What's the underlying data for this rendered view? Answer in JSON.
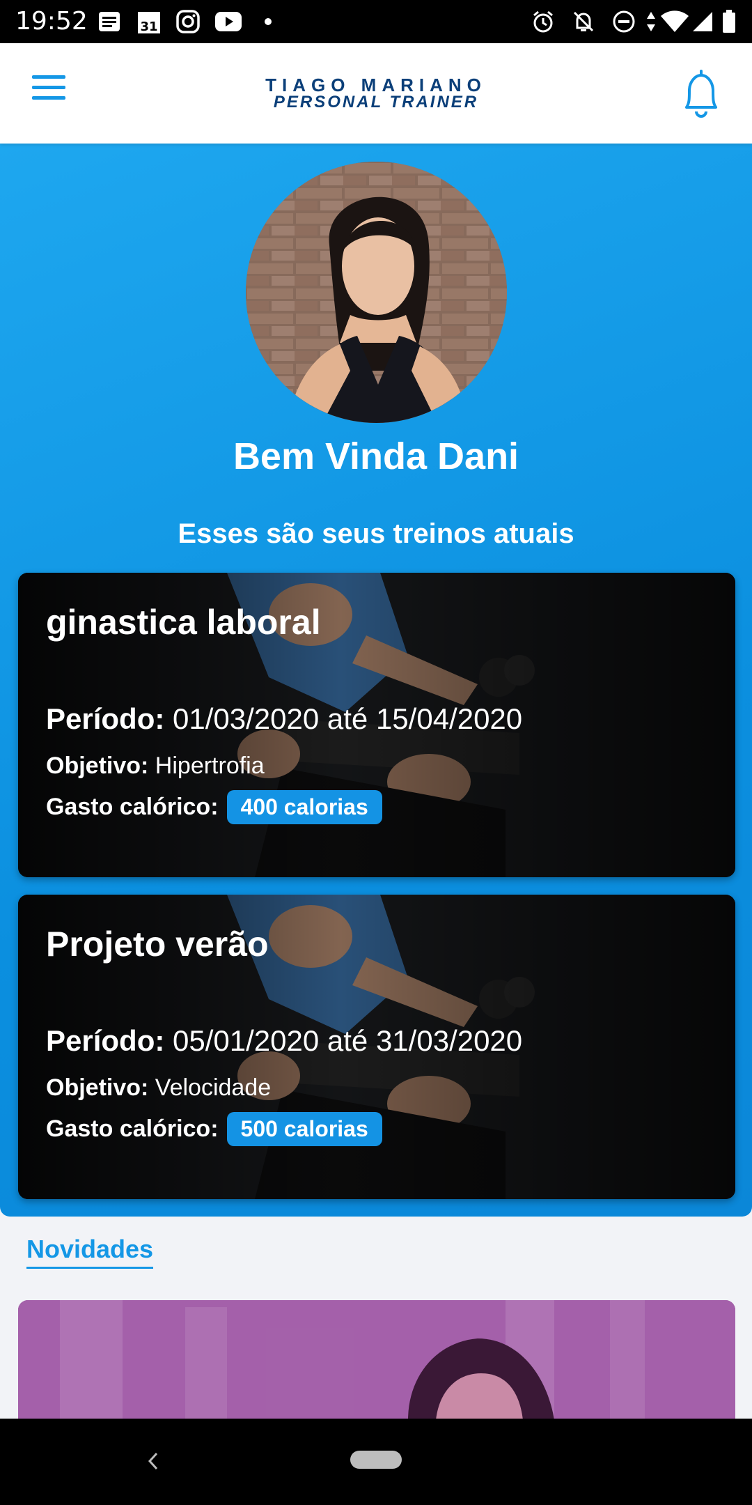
{
  "status_bar": {
    "time": "19:52",
    "icons": [
      "news-icon",
      "calendar-icon",
      "instagram-icon",
      "youtube-icon",
      "dot-icon",
      "alarm-icon",
      "notifications-off-icon",
      "do-not-disturb-icon",
      "data-icon",
      "wifi-icon",
      "signal-icon",
      "battery-icon"
    ],
    "calendar_day": "31"
  },
  "app_bar": {
    "logo_line1": "TIAGO MARIANO",
    "logo_line2": "PERSONAL TRAINER",
    "accent": "#1497e6",
    "logo_color": "#0b3f79"
  },
  "hero": {
    "welcome": "Bem Vinda Dani",
    "subtitle": "Esses são seus treinos atuais",
    "background": "#1497e6"
  },
  "workouts": [
    {
      "title": "ginastica laboral",
      "period_label": "Período:",
      "period_value": "01/03/2020 até 15/04/2020",
      "objective_label": "Objetivo:",
      "objective_value": "Hipertrofia",
      "calories_label": "Gasto calórico:",
      "calories_value": "400 calorias"
    },
    {
      "title": "Projeto verão",
      "period_label": "Período:",
      "period_value": "05/01/2020 até 31/03/2020",
      "objective_label": "Objetivo:",
      "objective_value": "Velocidade",
      "calories_label": "Gasto calórico:",
      "calories_value": "500 calorias"
    }
  ],
  "news": {
    "title": "Novidades"
  }
}
